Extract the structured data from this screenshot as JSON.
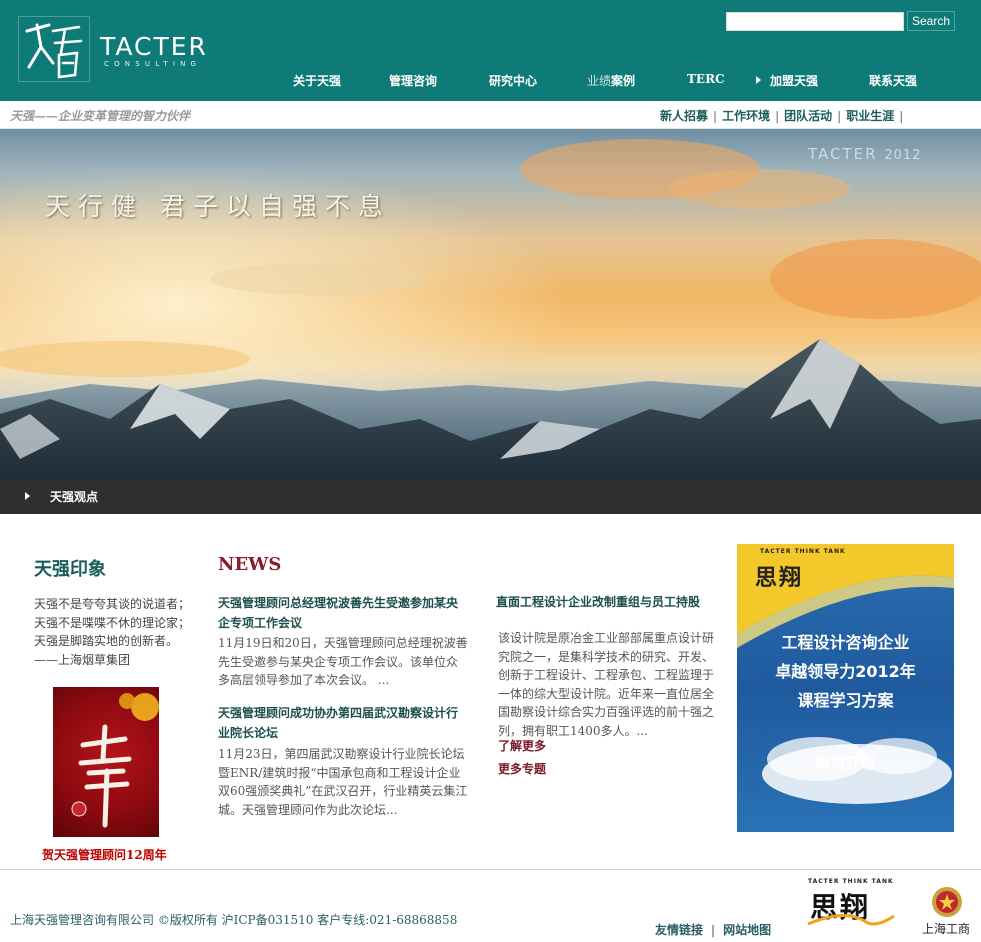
{
  "header": {
    "logo_text": "TACTER",
    "logo_subtext": "CONSULTING",
    "search_placeholder": "",
    "search_button": "Search"
  },
  "nav": [
    {
      "label": "关于天强"
    },
    {
      "label": "管理咨询"
    },
    {
      "label": "研究中心"
    },
    {
      "label_dim": "业绩",
      "label": "案例"
    },
    {
      "label": "TERC"
    },
    {
      "label": "加盟天强"
    },
    {
      "label": "联系天强"
    }
  ],
  "subbar": {
    "slogan": "天强——企业变革管理的智力伙伴",
    "links": [
      "新人招募",
      "工作环境",
      "团队活动",
      "职业生涯"
    ]
  },
  "banner": {
    "tagline": "天行健  君子以自强不息",
    "brand": "TACTER",
    "year": "2012"
  },
  "viewbar": {
    "label": "天强观点"
  },
  "impression": {
    "title": "天强印象",
    "lines": [
      "天强不是夸夸其谈的说道者；",
      "天强不是喋喋不休的理论家；",
      "天强是脚踏实地的创新者。",
      "——上海烟草集团"
    ],
    "poster_caption": "贺天强管理顾问12周年"
  },
  "news": {
    "title": "NEWS",
    "items": [
      {
        "title": "天强管理顾问总经理祝波善先生受邀参加某央企专项工作会议",
        "text": "11月19日和20日，天强管理顾问总经理祝波善先生受邀参与某央企专项工作会议。该单位众多高层领导参加了本次会议。 ..."
      },
      {
        "title": "天强管理顾问成功协办第四届武汉勘察设计行业院长论坛",
        "text": "11月23日，第四届武汉勘察设计行业院长论坛暨ENR/建筑时报“中国承包商和工程设计企业双60强颁奖典礼”在武汉召开，行业精英云集江城。天强管理顾问作为此次论坛..."
      }
    ]
  },
  "feature": {
    "title": "直面工程设计企业改制重组与员工持股",
    "text": "该设计院是原冶金工业部部属重点设计研究院之一，是集科学技术的研究、开发、创新于工程设计、工程承包、工程监理于一体的综大型设计院。近年来一直位居全国勘察设计综合实力百强评选的前十强之列，拥有职工1400多人。...",
    "learn_more": "了解更多",
    "more_topics": "更多专题"
  },
  "ad": {
    "brand_small": "TACTER THINK TANK",
    "brand": "思翔",
    "line1": "工程设计咨询企业",
    "line2": "卓越领导力2012年",
    "line3": "课程学习方案",
    "monthly": "每月开班"
  },
  "footer": {
    "copyright": "上海天强管理咨询有限公司 ©版权所有 沪ICP备031510 客户专线:021-68868858",
    "links": [
      "友情链接",
      "网站地图"
    ],
    "logo_small": "TACTER THINK TANK",
    "logo_big": "思翔",
    "badge_label": "上海工商"
  },
  "colors": {
    "header_teal": "#0f7b78",
    "news_title": "#8b1a2a",
    "impression_title": "#1a5e5c"
  }
}
